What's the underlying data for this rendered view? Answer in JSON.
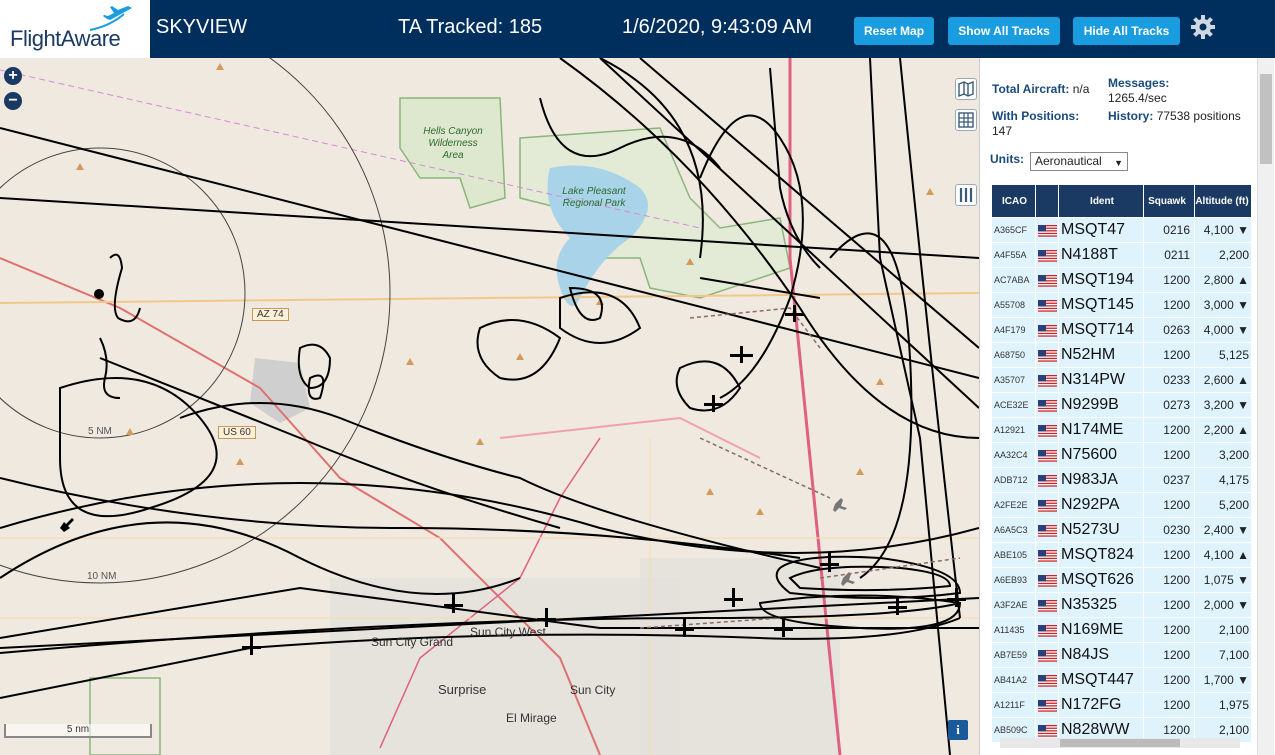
{
  "header": {
    "logo_text": "FlightAware",
    "app_name": "SKYVIEW",
    "ta_tracked": "TA Tracked: 185",
    "timestamp": "1/6/2020, 9:43:09 AM",
    "reset_map": "Reset Map",
    "show_all_tracks": "Show All Tracks",
    "hide_all_tracks": "Hide All Tracks"
  },
  "colors": {
    "header_bg": "#002f5d",
    "button_bg": "#1a9de0",
    "table_header_bg": "#1a3a63",
    "table_row_bg": "#dff3fc",
    "map_bg": "#efe9df",
    "track_line": "#000000"
  },
  "map": {
    "labels": {
      "hells_canyon": "Hells Canyon Wilderness Area",
      "lake_pleasant": "Lake Pleasant Regional Park",
      "az74": "AZ 74",
      "us60": "US 60",
      "five_nm": "5 NM",
      "ten_nm": "10 NM",
      "sun_city_grand": "Sun City Grand",
      "sun_city_west": "Sun City West",
      "surprise": "Surprise",
      "sun_city": "Sun City",
      "el_mirage": "El Mirage"
    },
    "scale": "5 nm",
    "zoom_in": "+",
    "zoom_out": "−",
    "info": "i"
  },
  "stats": {
    "total_aircraft_label": "Total Aircraft:",
    "total_aircraft_value": "n/a",
    "messages_label": "Messages:",
    "messages_value": "1265.4/sec",
    "with_positions_label": "With Positions:",
    "with_positions_value": "147",
    "history_label": "History:",
    "history_value": "77538 positions"
  },
  "units": {
    "label": "Units:",
    "selected": "Aeronautical"
  },
  "table": {
    "headers": [
      "ICAO",
      "",
      "Ident",
      "Squawk",
      "Altitude (ft)"
    ],
    "rows": [
      {
        "icao": "A365CF",
        "ident": "MSQT47",
        "squawk": "0216",
        "altitude": "4,100 ▼"
      },
      {
        "icao": "A4F55A",
        "ident": "N4188T",
        "squawk": "0211",
        "altitude": "2,200"
      },
      {
        "icao": "AC7ABA",
        "ident": "MSQT194",
        "squawk": "1200",
        "altitude": "2,800 ▲"
      },
      {
        "icao": "A55708",
        "ident": "MSQT145",
        "squawk": "1200",
        "altitude": "3,000 ▼"
      },
      {
        "icao": "A4F179",
        "ident": "MSQT714",
        "squawk": "0263",
        "altitude": "4,000 ▼"
      },
      {
        "icao": "A68750",
        "ident": "N52HM",
        "squawk": "1200",
        "altitude": "5,125"
      },
      {
        "icao": "A35707",
        "ident": "N314PW",
        "squawk": "0233",
        "altitude": "2,600 ▲"
      },
      {
        "icao": "ACE32E",
        "ident": "N9299B",
        "squawk": "0273",
        "altitude": "3,200 ▼"
      },
      {
        "icao": "A12921",
        "ident": "N174ME",
        "squawk": "1200",
        "altitude": "2,200 ▲"
      },
      {
        "icao": "AA32C4",
        "ident": "N75600",
        "squawk": "1200",
        "altitude": "3,200"
      },
      {
        "icao": "ADB712",
        "ident": "N983JA",
        "squawk": "0237",
        "altitude": "4,175"
      },
      {
        "icao": "A2FE2E",
        "ident": "N292PA",
        "squawk": "1200",
        "altitude": "5,200"
      },
      {
        "icao": "A6A5C3",
        "ident": "N5273U",
        "squawk": "0230",
        "altitude": "2,400 ▼"
      },
      {
        "icao": "ABE105",
        "ident": "MSQT824",
        "squawk": "1200",
        "altitude": "4,100 ▲"
      },
      {
        "icao": "A6EB93",
        "ident": "MSQT626",
        "squawk": "1200",
        "altitude": "1,075 ▼"
      },
      {
        "icao": "A3F2AE",
        "ident": "N35325",
        "squawk": "1200",
        "altitude": "2,000 ▼"
      },
      {
        "icao": "A11435",
        "ident": "N169ME",
        "squawk": "1200",
        "altitude": "2,100"
      },
      {
        "icao": "AB7E59",
        "ident": "N84JS",
        "squawk": "1200",
        "altitude": "7,100"
      },
      {
        "icao": "AB41A2",
        "ident": "MSQT447",
        "squawk": "1200",
        "altitude": "1,700 ▼"
      },
      {
        "icao": "A1211F",
        "ident": "N172FG",
        "squawk": "1200",
        "altitude": "1,975"
      },
      {
        "icao": "AB509C",
        "ident": "N828WW",
        "squawk": "1200",
        "altitude": "2,100"
      }
    ]
  }
}
